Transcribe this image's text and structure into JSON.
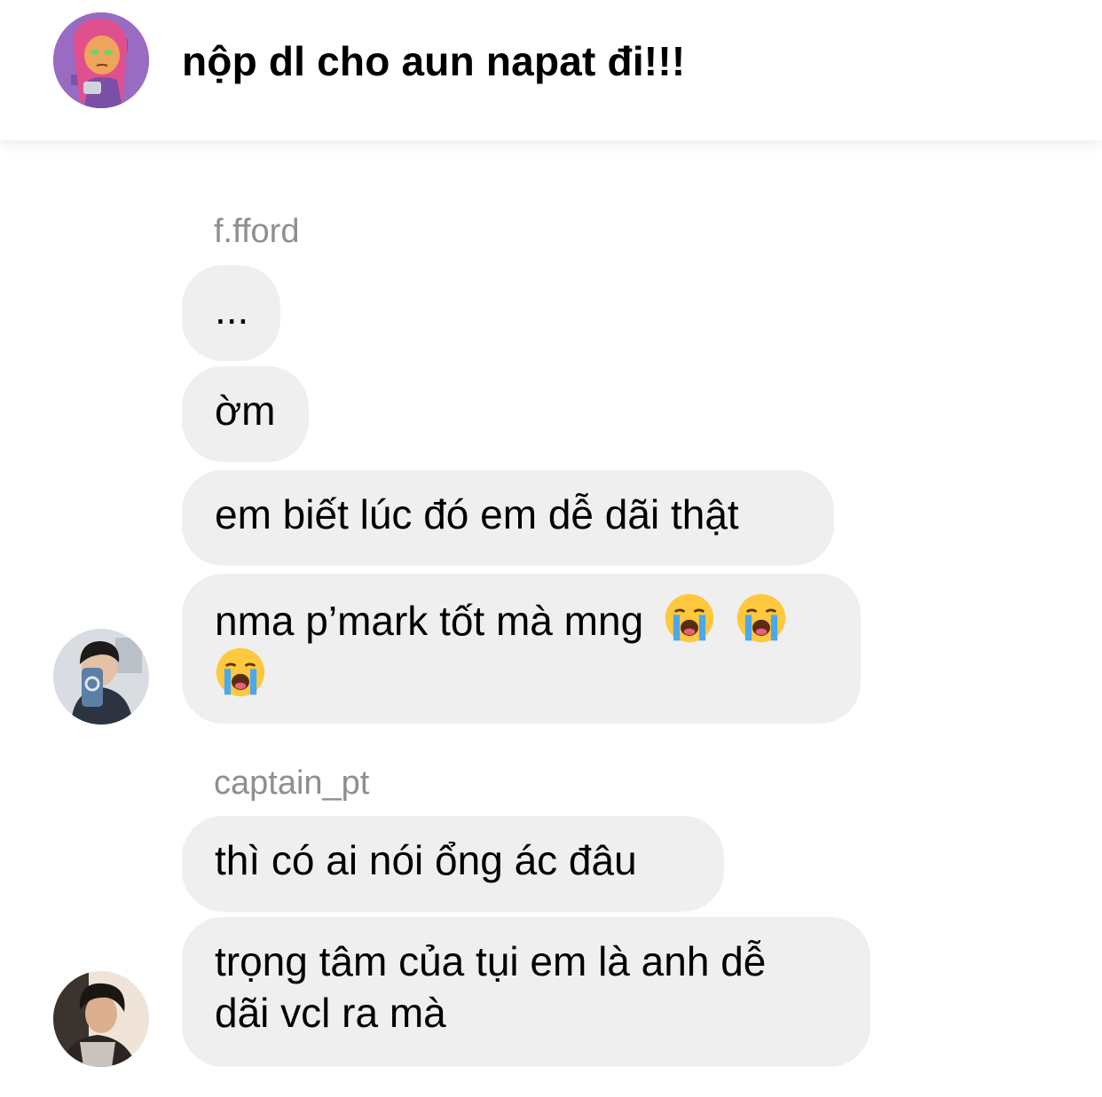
{
  "header": {
    "title": "nộp dl cho aun napat đi!!!",
    "avatar_icon": "cartoon-girl-avatar"
  },
  "groups": [
    {
      "sender": "f.fford",
      "messages": [
        {
          "text": "..."
        },
        {
          "text": "ờm"
        },
        {
          "text": "em biết lúc đó em dễ dãi thật"
        },
        {
          "lines": [
            "nma p’mark tốt mà mng",
            ""
          ],
          "emoji": "loudly-crying-face",
          "emoji_count": 3
        }
      ]
    },
    {
      "sender": "captain_pt",
      "messages": [
        {
          "text": "thì có ai nói ổng ác đâu"
        },
        {
          "lines": [
            "trọng tâm của tụi em là anh dễ",
            "dãi vcl ra mà"
          ]
        }
      ]
    }
  ],
  "colors": {
    "bubble": "#efefef",
    "sender_name": "#8e8e93",
    "text": "#000000"
  }
}
